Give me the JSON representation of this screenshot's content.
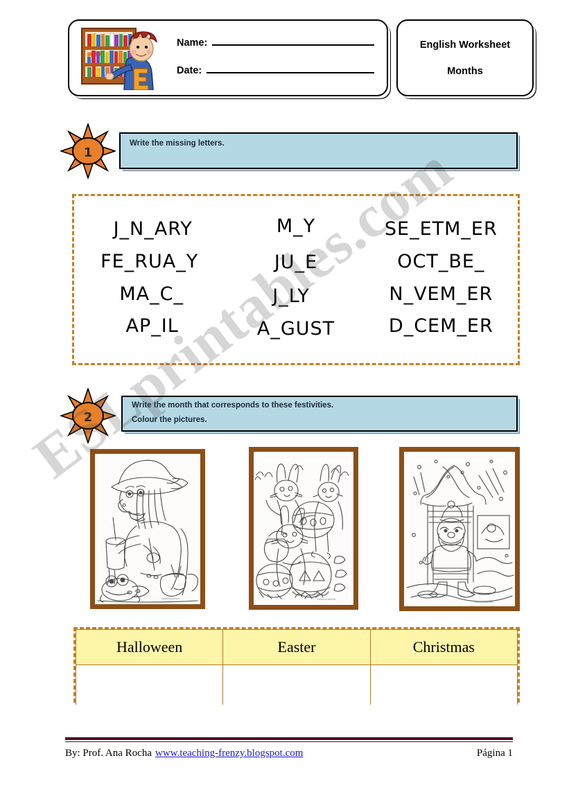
{
  "header": {
    "clipart_name": "boy-at-bookshelf-clipart",
    "name_label": "Name:",
    "date_label": "Date:",
    "worksheet_title": "English Worksheet",
    "worksheet_subject": "Months"
  },
  "tasks": [
    {
      "number": "1",
      "lines": [
        "Write the missing letters."
      ]
    },
    {
      "number": "2",
      "lines": [
        "Write the month that corresponds to these festivities.",
        "Colour the pictures."
      ]
    }
  ],
  "months": {
    "columns": [
      [
        "J_N_ARY",
        "FE_RUA_Y",
        "MA_C_",
        "AP_IL"
      ],
      [
        "M_Y",
        "JU_E",
        "J_LY",
        "A_GUST"
      ],
      [
        "SE_ETM_ER",
        "OCT_BE_",
        "N_VEM_ER",
        "D_CEM_ER"
      ]
    ]
  },
  "pictures": [
    {
      "alt": "witch-cooking-potion-coloring-picture"
    },
    {
      "alt": "easter-bunnies-and-eggs-coloring-picture"
    },
    {
      "alt": "santa-claus-in-snow-coloring-picture"
    }
  ],
  "answer_table": {
    "headers": [
      "Halloween",
      "Easter",
      "Christmas"
    ],
    "answers": [
      "",
      "",
      ""
    ]
  },
  "footer": {
    "author": "By: Prof. Ana Rocha",
    "url": "www.teaching-frenzy.blogspot.com",
    "page": "Página 1"
  },
  "watermark": {
    "text": "ESLprintables.com"
  },
  "colors": {
    "instruction_bg": "#b5d8e5",
    "dashed_border": "#c5801f",
    "table_header_bg": "#fdf6a8",
    "frame_border": "#8b4f17",
    "sun_fill": "#e8802a",
    "footer_rule": "#4a1028",
    "link": "#1a1ad0"
  }
}
